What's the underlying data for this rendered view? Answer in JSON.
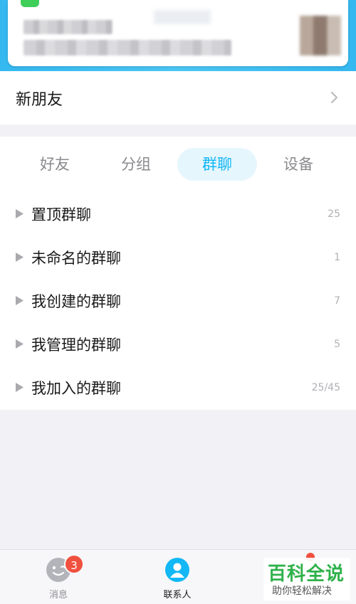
{
  "new_friends": {
    "label": "新朋友"
  },
  "tabs": [
    {
      "label": "好友"
    },
    {
      "label": "分组"
    },
    {
      "label": "群聊",
      "active": true
    },
    {
      "label": "设备"
    }
  ],
  "groups": [
    {
      "name": "置顶群聊",
      "count": "25"
    },
    {
      "name": "未命名的群聊",
      "count": "1"
    },
    {
      "name": "我创建的群聊",
      "count": "7"
    },
    {
      "name": "我管理的群聊",
      "count": "5"
    },
    {
      "name": "我加入的群聊",
      "count": "25/45"
    }
  ],
  "bottom_nav": {
    "messages": {
      "label": "消息",
      "badge": "3",
      "icon": "chat-face-icon"
    },
    "contacts": {
      "label": "联系人",
      "icon": "contacts-person-icon"
    }
  },
  "watermark": {
    "title": "百科全说",
    "subtitle": "助你轻松解决"
  },
  "colors": {
    "accent": "#12b7f5",
    "badge": "#f0513f",
    "watermark": "#2fb14a"
  }
}
